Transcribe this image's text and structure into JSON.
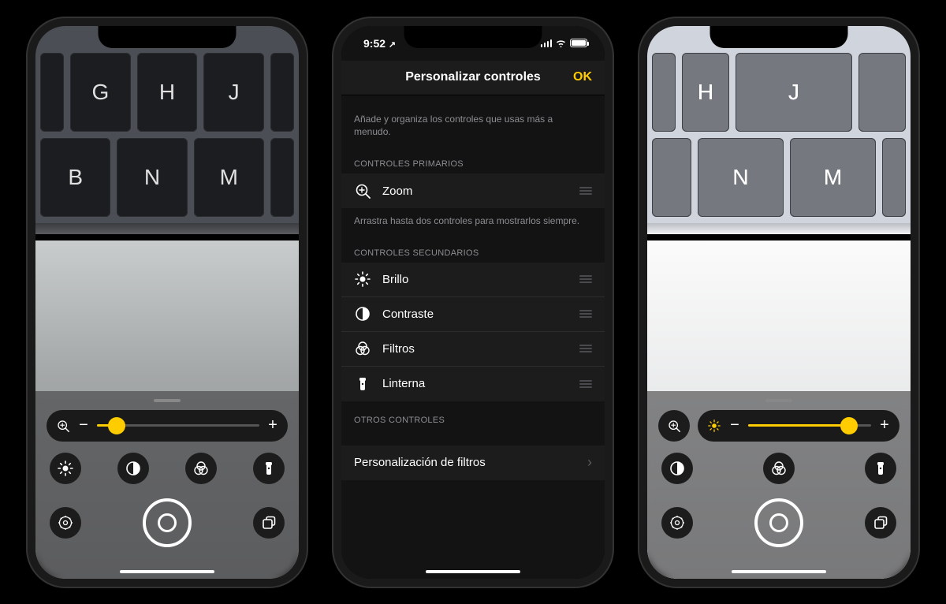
{
  "phone1": {
    "keys_row1": [
      "G",
      "H",
      "J"
    ],
    "keys_row2": [
      "B",
      "N",
      "M"
    ]
  },
  "phone3": {
    "keys_row1": [
      "H",
      "J"
    ],
    "keys_row2": [
      "N",
      "M"
    ]
  },
  "magnifier": {
    "slider_value": 12,
    "brightness_slider_value": 82
  },
  "settings": {
    "status_time": "9:52",
    "title": "Personalizar controles",
    "ok": "OK",
    "intro": "Añade y organiza los controles que usas más a menudo.",
    "section_primary": "CONTROLES PRIMARIOS",
    "primary_items": [
      {
        "icon": "zoom",
        "label": "Zoom"
      }
    ],
    "primary_hint": "Arrastra hasta dos controles para mostrarlos siempre.",
    "section_secondary": "CONTROLES SECUNDARIOS",
    "secondary_items": [
      {
        "icon": "brightness",
        "label": "Brillo"
      },
      {
        "icon": "contrast",
        "label": "Contraste"
      },
      {
        "icon": "filters",
        "label": "Filtros"
      },
      {
        "icon": "flashlight",
        "label": "Linterna"
      }
    ],
    "section_other": "OTROS CONTROLES",
    "filter_customization": "Personalización de filtros"
  }
}
